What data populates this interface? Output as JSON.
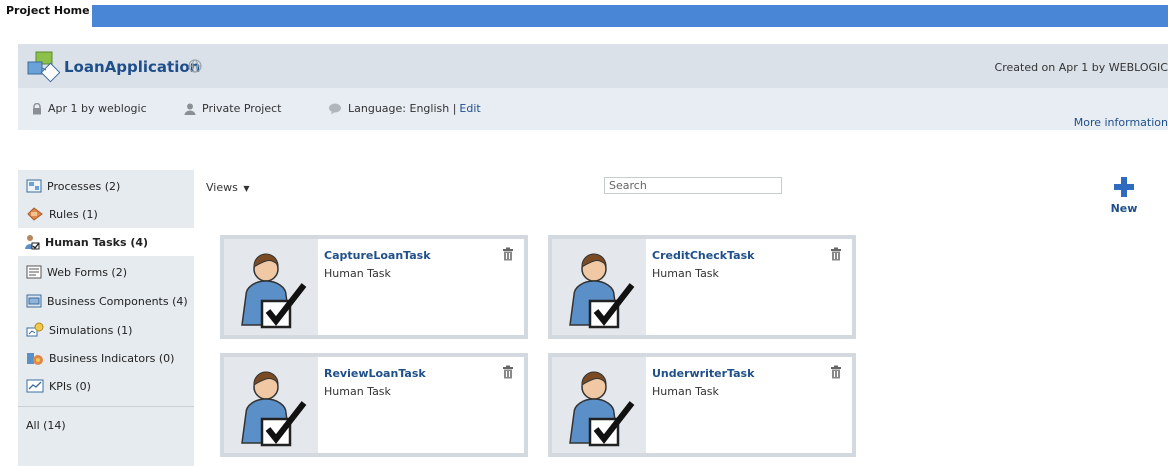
{
  "topbar": {
    "tab_label": "Project Home"
  },
  "project": {
    "name": "LoanApplication",
    "created": "Created on Apr 1 by WEBLOGIC",
    "modified": "Apr 1 by weblogic",
    "visibility": "Private Project",
    "language_label": "Language: English |",
    "edit_label": "Edit",
    "more_info": "More information"
  },
  "sidebar": {
    "items": [
      {
        "label": "Processes (2)",
        "icon": "processes-icon"
      },
      {
        "label": "Rules (1)",
        "icon": "rules-icon"
      },
      {
        "label": "Human Tasks (4)",
        "icon": "human-tasks-icon",
        "active": true
      },
      {
        "label": "Web Forms (2)",
        "icon": "web-forms-icon"
      },
      {
        "label": "Business Components (4)",
        "icon": "business-components-icon"
      },
      {
        "label": "Simulations (1)",
        "icon": "simulations-icon"
      },
      {
        "label": "Business Indicators (0)",
        "icon": "business-indicators-icon"
      },
      {
        "label": "KPIs (0)",
        "icon": "kpis-icon"
      }
    ],
    "all_label": "All (14)"
  },
  "toolbar": {
    "views_label": "Views",
    "search_placeholder": "Search",
    "new_label": "New"
  },
  "cards": [
    {
      "title": "CaptureLoanTask",
      "type": "Human Task"
    },
    {
      "title": "CreditCheckTask",
      "type": "Human Task"
    },
    {
      "title": "ReviewLoanTask",
      "type": "Human Task"
    },
    {
      "title": "UnderwriterTask",
      "type": "Human Task"
    }
  ],
  "colors": {
    "accent_blue": "#4a86d6",
    "link_blue": "#1f4f8a",
    "panel_gray": "#dbe1e8"
  }
}
